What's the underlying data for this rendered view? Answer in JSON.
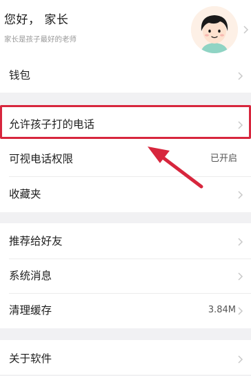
{
  "profile": {
    "greeting": "您好， 家长",
    "subtitle": "家长是孩子最好的老师"
  },
  "groups": [
    {
      "rows": [
        {
          "label": "钱包",
          "value": ""
        }
      ]
    },
    {
      "rows": [
        {
          "label": "允许孩子打的电话",
          "value": ""
        },
        {
          "label": "可视电话权限",
          "value": "已开启"
        },
        {
          "label": "收藏夹",
          "value": ""
        }
      ]
    },
    {
      "rows": [
        {
          "label": "推荐给好友",
          "value": ""
        },
        {
          "label": "系统消息",
          "value": ""
        },
        {
          "label": "清理缓存",
          "value": "3.84M"
        }
      ]
    },
    {
      "rows": [
        {
          "label": "关于软件",
          "value": ""
        }
      ]
    }
  ],
  "colors": {
    "annotation": "#d7263d",
    "background": "#f1f1f3"
  }
}
